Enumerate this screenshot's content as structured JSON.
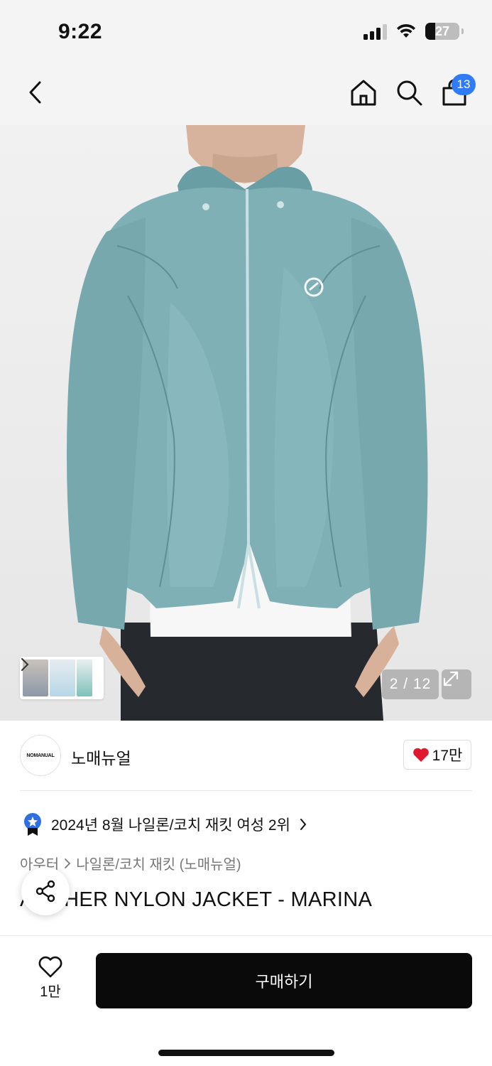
{
  "status_bar": {
    "time": "9:22",
    "battery": "27"
  },
  "nav": {
    "cart_count": "13",
    "icons": [
      "back-icon",
      "home-icon",
      "search-icon",
      "shopping-bag-icon"
    ]
  },
  "gallery": {
    "counter": "2 / 12",
    "expand_icon": "expand-icon"
  },
  "brand": {
    "logo_text": "NOMANUAL",
    "name": "노매뉴얼",
    "likes": "17만",
    "heart_color": "#e0182f"
  },
  "ranking": {
    "text": "2024년 8월 나일론/코치 재킷 여성 2위",
    "badge_color": "#2f6fe0"
  },
  "breadcrumb": {
    "category": "아우터",
    "subcategory": "나일론/코치 재킷 (노매뉴얼)"
  },
  "product": {
    "title": "ARCHER NYLON JACKET - MARINA"
  },
  "bottom": {
    "wish_count": "1만",
    "buy_label": "구매하기"
  }
}
